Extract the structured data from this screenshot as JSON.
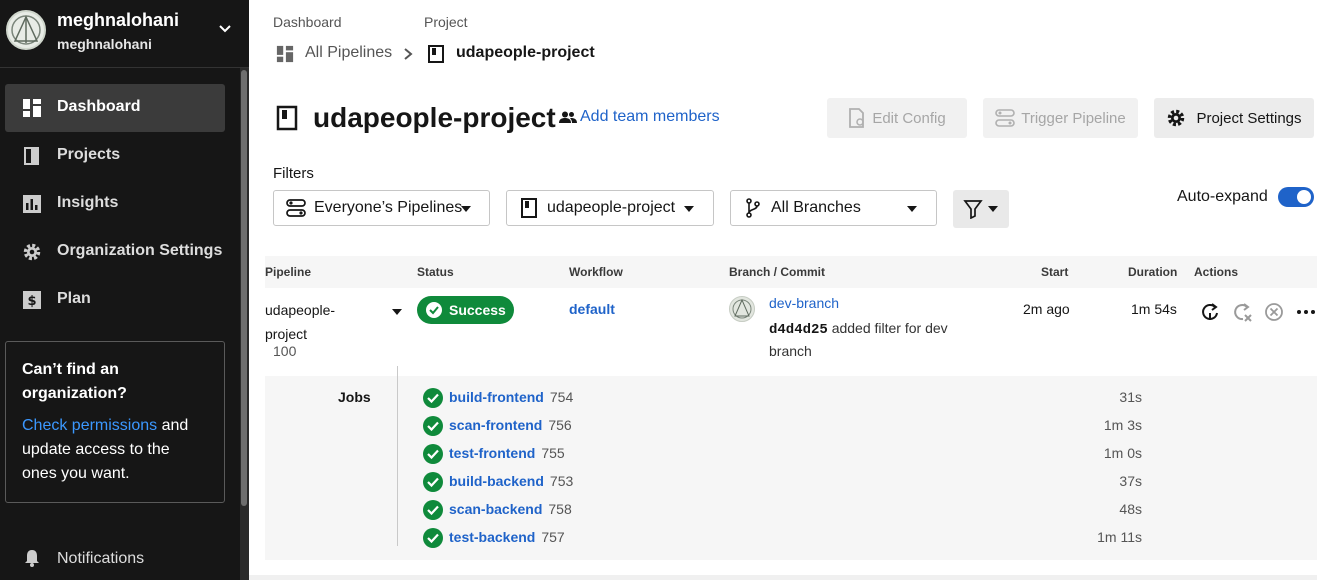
{
  "user": {
    "name": "meghnalohani",
    "org": "meghnalohani"
  },
  "sidebar": {
    "items": [
      {
        "label": "Dashboard",
        "icon": "dashboard-icon",
        "active": true
      },
      {
        "label": "Projects",
        "icon": "projects-icon",
        "active": false
      },
      {
        "label": "Insights",
        "icon": "insights-icon",
        "active": false
      },
      {
        "label": "Organization Settings",
        "icon": "gear-icon",
        "active": false
      },
      {
        "label": "Plan",
        "icon": "plan-icon",
        "active": false
      }
    ],
    "org_box": {
      "title": "Can’t find an organization?",
      "link": "Check permissions",
      "text": " and update access to the ones you want."
    },
    "notifications": "Notifications"
  },
  "breadcrumb": {
    "dashboard_label": "Dashboard",
    "project_label": "Project",
    "all_pipelines": "All Pipelines",
    "separator": ">",
    "project": "udapeople-project"
  },
  "header": {
    "title": "udapeople-project",
    "add_team": "Add team members",
    "edit_config": "Edit Config",
    "trigger_pipeline": "Trigger Pipeline",
    "project_settings": "Project Settings"
  },
  "filters": {
    "label": "Filters",
    "pipelines": "Everyone’s Pipelines",
    "project": "udapeople-project",
    "branches": "All Branches",
    "auto_expand": "Auto-expand",
    "auto_expand_on": true
  },
  "table": {
    "headers": {
      "pipeline": "Pipeline",
      "status": "Status",
      "workflow": "Workflow",
      "branch_commit": "Branch / Commit",
      "start": "Start",
      "duration": "Duration",
      "actions": "Actions"
    },
    "row": {
      "pipeline_name": "udapeople-project",
      "pipeline_number": "100",
      "status": "Success",
      "workflow": "default",
      "branch": "dev-branch",
      "commit_hash": "d4d4d25",
      "commit_message": "added filter for dev branch",
      "start": "2m ago",
      "duration": "1m 54s"
    },
    "jobs_label": "Jobs",
    "jobs": [
      {
        "name": "build-frontend",
        "number": "754",
        "duration": "31s"
      },
      {
        "name": "scan-frontend",
        "number": "756",
        "duration": "1m 3s"
      },
      {
        "name": "test-frontend",
        "number": "755",
        "duration": "1m 0s"
      },
      {
        "name": "build-backend",
        "number": "753",
        "duration": "37s"
      },
      {
        "name": "scan-backend",
        "number": "758",
        "duration": "48s"
      },
      {
        "name": "test-backend",
        "number": "757",
        "duration": "1m 11s"
      }
    ]
  },
  "colors": {
    "sidebar_bg": "#161616",
    "link_blue": "#1f63c9",
    "success_green": "#0f8a3b"
  }
}
